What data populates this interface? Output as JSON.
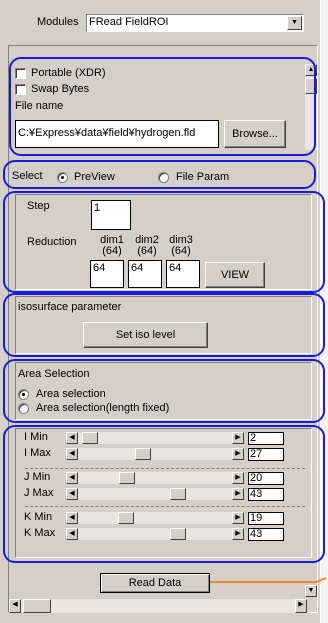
{
  "modules": {
    "label": "Modules",
    "value": "FRead FieldROI"
  },
  "file": {
    "portable_label": "Portable (XDR)",
    "portable_checked": false,
    "swap_label": "Swap Bytes",
    "swap_checked": false,
    "filename_label": "File name",
    "filename_value": "C:¥Express¥data¥field¥hydrogen.fld",
    "browse_label": "Browse..."
  },
  "select": {
    "label": "Select",
    "options": [
      "PreView",
      "File Param"
    ],
    "selected": "PreView"
  },
  "step": {
    "label": "Step",
    "value": "1"
  },
  "reduction": {
    "label": "Reduction",
    "dims": [
      {
        "name": "dim1",
        "size": "(64)",
        "value": "64"
      },
      {
        "name": "dim2",
        "size": "(64)",
        "value": "64"
      },
      {
        "name": "dim3",
        "size": "(64)",
        "value": "64"
      }
    ],
    "view_label": "VIEW"
  },
  "iso": {
    "title": "isosurface parameter",
    "button_label": "Set iso level"
  },
  "area": {
    "title": "Area Selection",
    "options": [
      "Area selection",
      "Area selection(length fixed)"
    ],
    "selected": "Area selection"
  },
  "sliders": [
    {
      "label": "I Min",
      "value": "2",
      "fraction": 0.03
    },
    {
      "label": "I Max",
      "value": "27",
      "fraction": 0.41
    },
    {
      "label": "J Min",
      "value": "20",
      "fraction": 0.3
    },
    {
      "label": "J Max",
      "value": "43",
      "fraction": 0.67
    },
    {
      "label": "K Min",
      "value": "19",
      "fraction": 0.29
    },
    {
      "label": "K Max",
      "value": "43",
      "fraction": 0.67
    }
  ],
  "read_button_label": "Read Data",
  "colors": {
    "annotation": "#1a1adc",
    "callout": "#f08c1e",
    "background": "#d4d0c8"
  }
}
